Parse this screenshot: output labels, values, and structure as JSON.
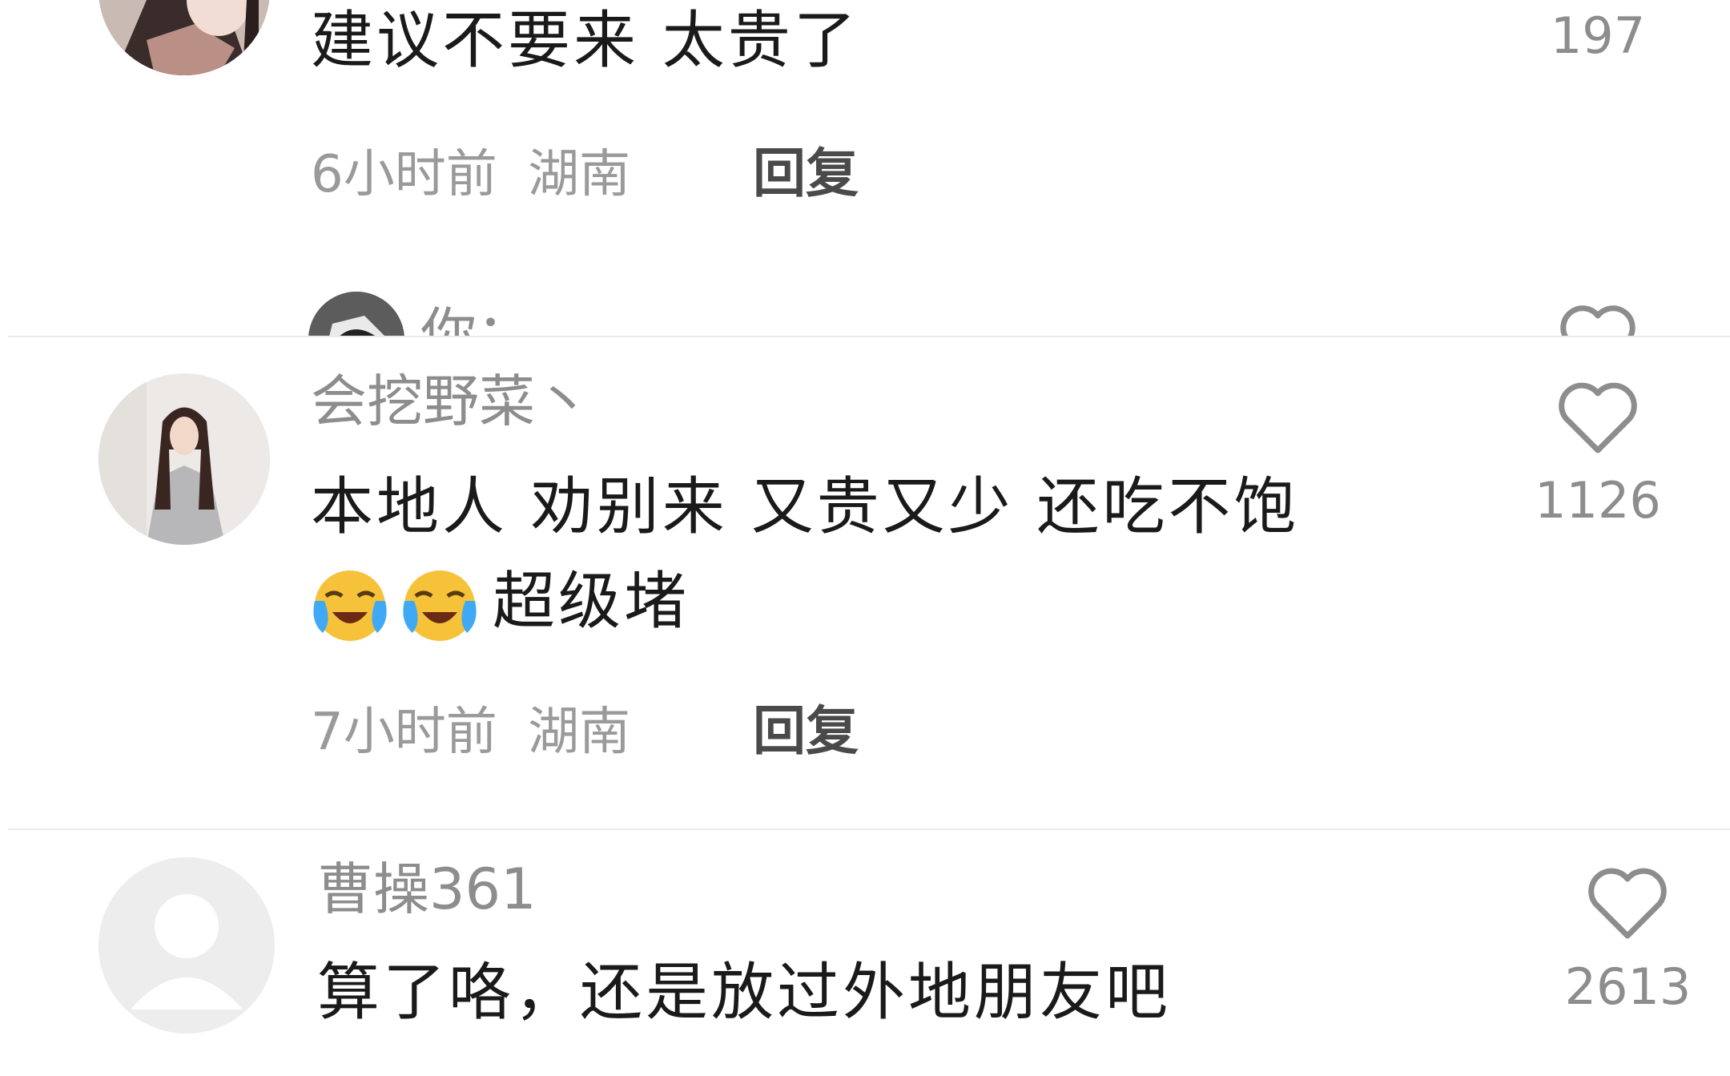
{
  "comments": [
    {
      "text": "建议不要来 太贵了",
      "likes": "197",
      "time": "6小时前",
      "location": "湖南",
      "reply_label": "回复",
      "sub_reply_partial": "你："
    },
    {
      "username": "会挖野菜丶",
      "text_line1": "本地人 劝别来 又贵又少 还吃不饱",
      "text_line2": "超级堵",
      "emojis": [
        "loudly-crying-face-icon",
        "loudly-crying-face-icon"
      ],
      "likes": "1126",
      "time": "7小时前",
      "location": "湖南",
      "reply_label": "回复"
    },
    {
      "username": "曹操361",
      "text": "算了咯，还是放过外地朋友吧",
      "likes": "2613"
    }
  ]
}
